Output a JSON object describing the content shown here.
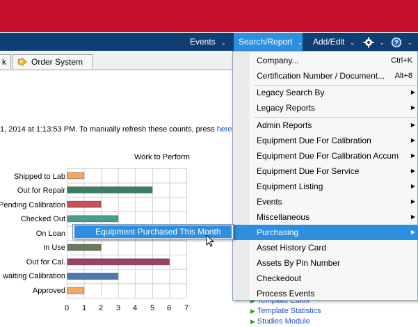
{
  "nav": {
    "events": "Events",
    "search_report": "Search/Report",
    "add_edit": "Add/Edit"
  },
  "tabs": {
    "partial": "k",
    "order_system": "Order System"
  },
  "status": {
    "text": "1, 2014 at 1:13:53 PM.  To manually refresh these counts, press ",
    "link": "here"
  },
  "chart_data": {
    "type": "bar",
    "title": "Work to Perform",
    "categories": [
      "Shipped to Lab",
      "Out for Repair",
      "Pending Calibration",
      "Checked Out",
      "On Loan",
      "In Use",
      "Out for Cal.",
      "Awaiting Calibration",
      "Approved"
    ],
    "category_labels": [
      "Shipped to Lab",
      "Out for Repair",
      "Pending Calibration",
      "Checked Out",
      "On Loan",
      "In Use",
      "Out for Cal.",
      "waiting Calibration",
      "Approved"
    ],
    "values": [
      1,
      5,
      2,
      3,
      0,
      2,
      6,
      3,
      1
    ],
    "colors": [
      "#f5a860",
      "#3a7d64",
      "#c8505a",
      "#4aa08c",
      "#4a8ac0",
      "#6a7a5a",
      "#a0406a",
      "#4a7ab0",
      "#f5a860"
    ],
    "x_ticks": [
      "0",
      "1",
      "2",
      "3",
      "4",
      "5",
      "6",
      "7"
    ],
    "xlim": [
      0,
      7
    ],
    "grid": true
  },
  "menu": {
    "items": [
      {
        "label": "Company...",
        "shortcut": "Ctrl+K",
        "arrow": false
      },
      {
        "label": "Certification Number / Document...",
        "shortcut": "Alt+8",
        "arrow": false
      },
      {
        "label": "Legacy Search By",
        "shortcut": "",
        "arrow": true
      },
      {
        "label": "Legacy Reports",
        "shortcut": "",
        "arrow": true
      },
      {
        "label": "Admin Reports",
        "shortcut": "",
        "arrow": true
      },
      {
        "label": "Equipment Due For Calibration",
        "shortcut": "",
        "arrow": true
      },
      {
        "label": "Equipment Due For Calibration Accum",
        "shortcut": "",
        "arrow": true
      },
      {
        "label": "Equipment Due For Service",
        "shortcut": "",
        "arrow": true
      },
      {
        "label": "Equipment Listing",
        "shortcut": "",
        "arrow": true
      },
      {
        "label": "Events",
        "shortcut": "",
        "arrow": true
      },
      {
        "label": "Miscellaneous",
        "shortcut": "",
        "arrow": true
      },
      {
        "label": "Purchasing",
        "shortcut": "",
        "arrow": true
      },
      {
        "label": "Asset History Card",
        "shortcut": "",
        "arrow": false
      },
      {
        "label": "Assets By Pin Number",
        "shortcut": "",
        "arrow": false
      },
      {
        "label": "Checkedout",
        "shortcut": "",
        "arrow": false
      },
      {
        "label": "Process Events",
        "shortcut": "",
        "arrow": false
      }
    ]
  },
  "submenu": {
    "item": "Equipment Purchased This Month"
  },
  "links": [
    {
      "label": "Template Editor"
    },
    {
      "label": "Template Statistics"
    },
    {
      "label": "Studies Module"
    }
  ],
  "colors": {
    "red_bar": "#c8102e",
    "nav_bg": "#0f3e73",
    "highlight": "#2d8fe0"
  }
}
